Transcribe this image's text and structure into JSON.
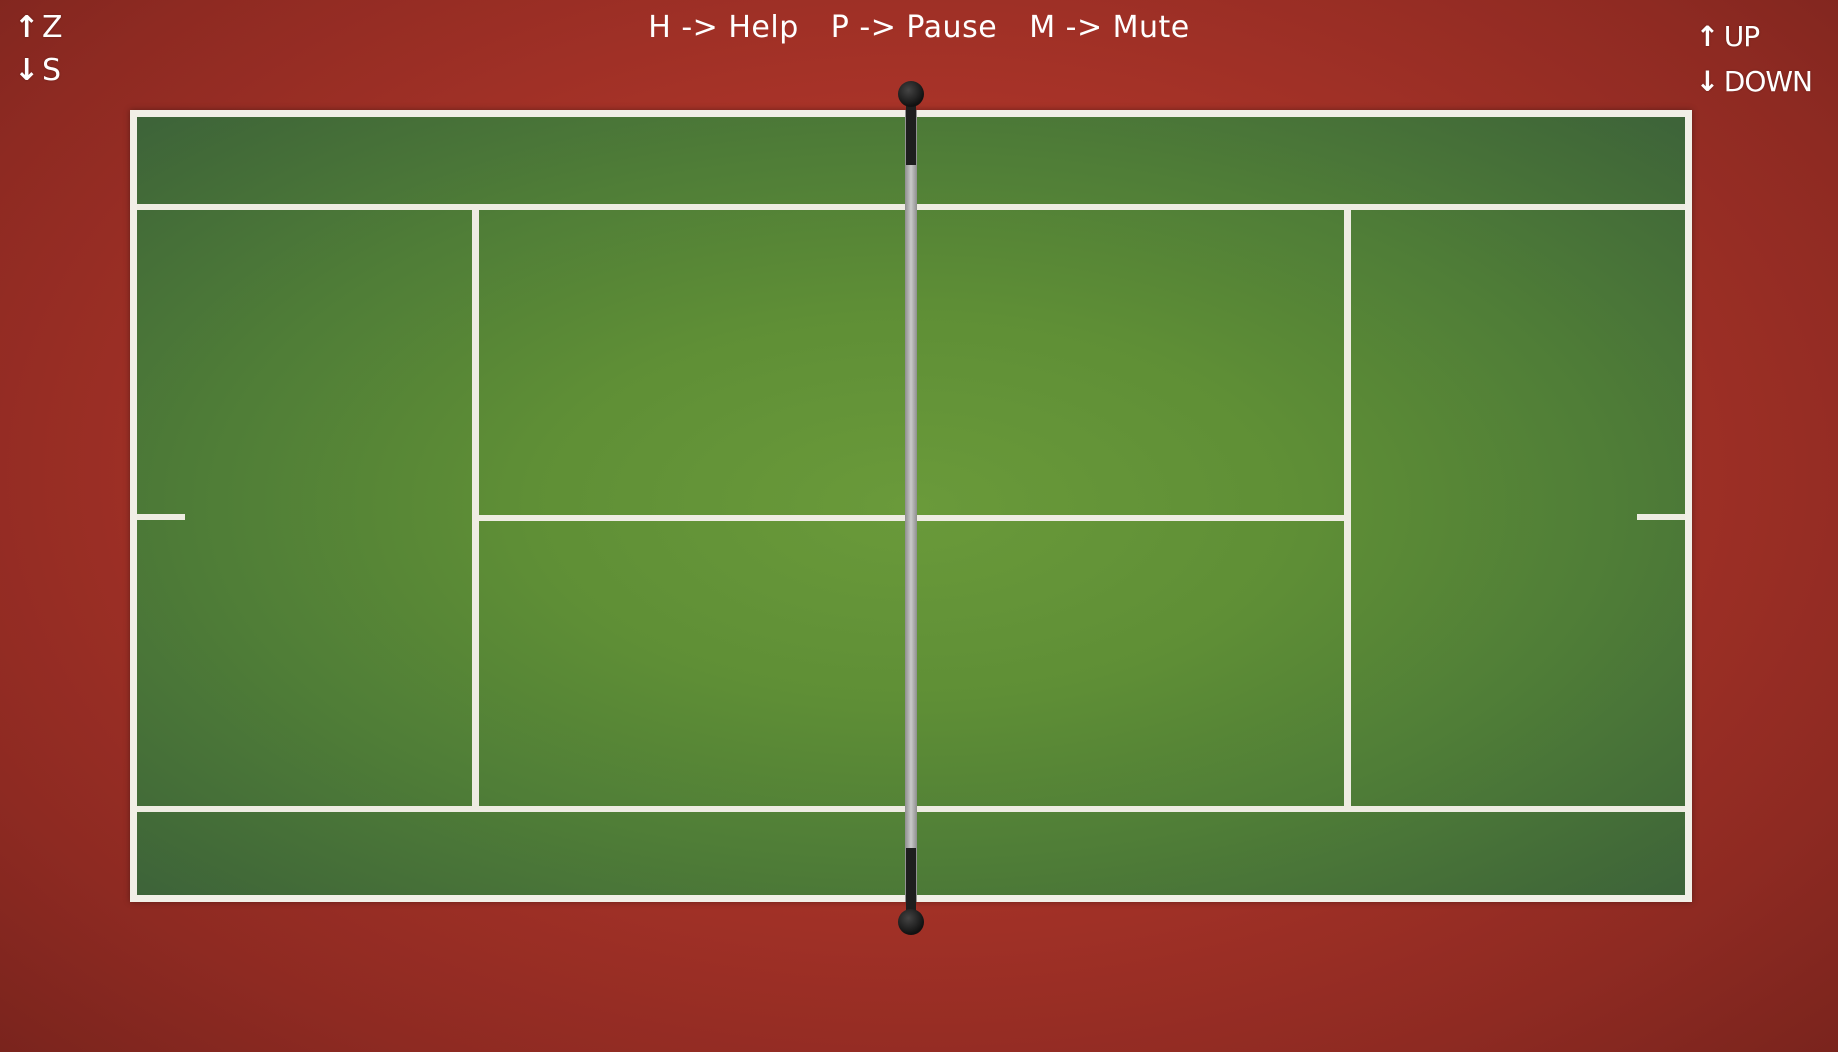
{
  "controls": {
    "player_left": {
      "up_arrow": "↑",
      "up_key": "Z",
      "down_arrow": "↓",
      "down_key": "S"
    },
    "player_right": {
      "up_arrow": "↑",
      "up_key": "UP",
      "down_arrow": "↓",
      "down_key": "DOWN"
    }
  },
  "help_bar": {
    "help": "H -> Help",
    "pause": "P -> Pause",
    "mute": "M -> Mute"
  },
  "colors": {
    "surround": "#a83328",
    "court_green": "#5f8f36",
    "court_edge": "#3d6339",
    "lines": "#eeece2",
    "net": "#b0b0b0",
    "net_posts": "#111111"
  }
}
